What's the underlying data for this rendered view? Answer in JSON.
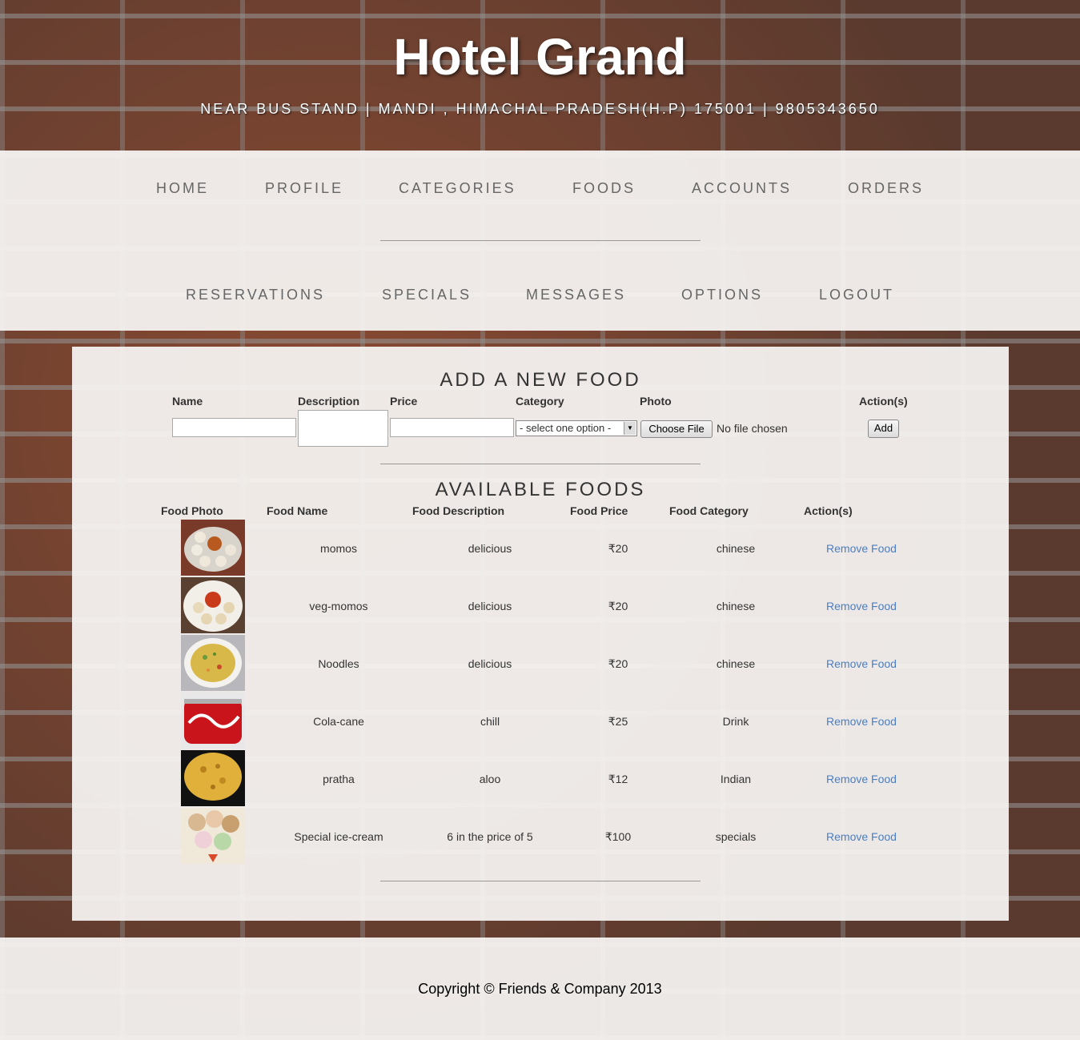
{
  "header": {
    "title": "Hotel Grand",
    "tagline": "NEAR BUS STAND | MANDI , HIMACHAL PRADESH(H.P) 175001 | 9805343650"
  },
  "nav": {
    "row1": [
      "HOME",
      "PROFILE",
      "CATEGORIES",
      "FOODS",
      "ACCOUNTS",
      "ORDERS"
    ],
    "row2": [
      "RESERVATIONS",
      "SPECIALS",
      "MESSAGES",
      "OPTIONS",
      "LOGOUT"
    ]
  },
  "add_form": {
    "title": "ADD A NEW FOOD",
    "headers": {
      "name": "Name",
      "description": "Description",
      "price": "Price",
      "category": "Category",
      "photo": "Photo",
      "actions": "Action(s)"
    },
    "category_selected": "- select one option -",
    "choose_file_label": "Choose File",
    "file_status": "No file chosen",
    "add_button": "Add"
  },
  "foods": {
    "title": "AVAILABLE FOODS",
    "headers": {
      "photo": "Food Photo",
      "name": "Food Name",
      "description": "Food Description",
      "price": "Food Price",
      "category": "Food Category",
      "actions": "Action(s)"
    },
    "items": [
      {
        "name": "momos",
        "description": "delicious",
        "price": "₹20",
        "category": "chinese",
        "action": "Remove Food",
        "photo_icon": "momos-photo"
      },
      {
        "name": "veg-momos",
        "description": "delicious",
        "price": "₹20",
        "category": "chinese",
        "action": "Remove Food",
        "photo_icon": "veg-momos-photo"
      },
      {
        "name": "Noodles",
        "description": "delicious",
        "price": "₹20",
        "category": "chinese",
        "action": "Remove Food",
        "photo_icon": "noodles-photo"
      },
      {
        "name": "Cola-cane",
        "description": "chill",
        "price": "₹25",
        "category": "Drink",
        "action": "Remove Food",
        "photo_icon": "cola-photo"
      },
      {
        "name": "pratha",
        "description": "aloo",
        "price": "₹12",
        "category": "Indian",
        "action": "Remove Food",
        "photo_icon": "pratha-photo"
      },
      {
        "name": "Special ice-cream",
        "description": "6 in the price of 5",
        "price": "₹100",
        "category": "specials",
        "action": "Remove Food",
        "photo_icon": "ice-cream-photo"
      }
    ]
  },
  "footer": {
    "copyright": "Copyright © Friends & Company 2013"
  }
}
